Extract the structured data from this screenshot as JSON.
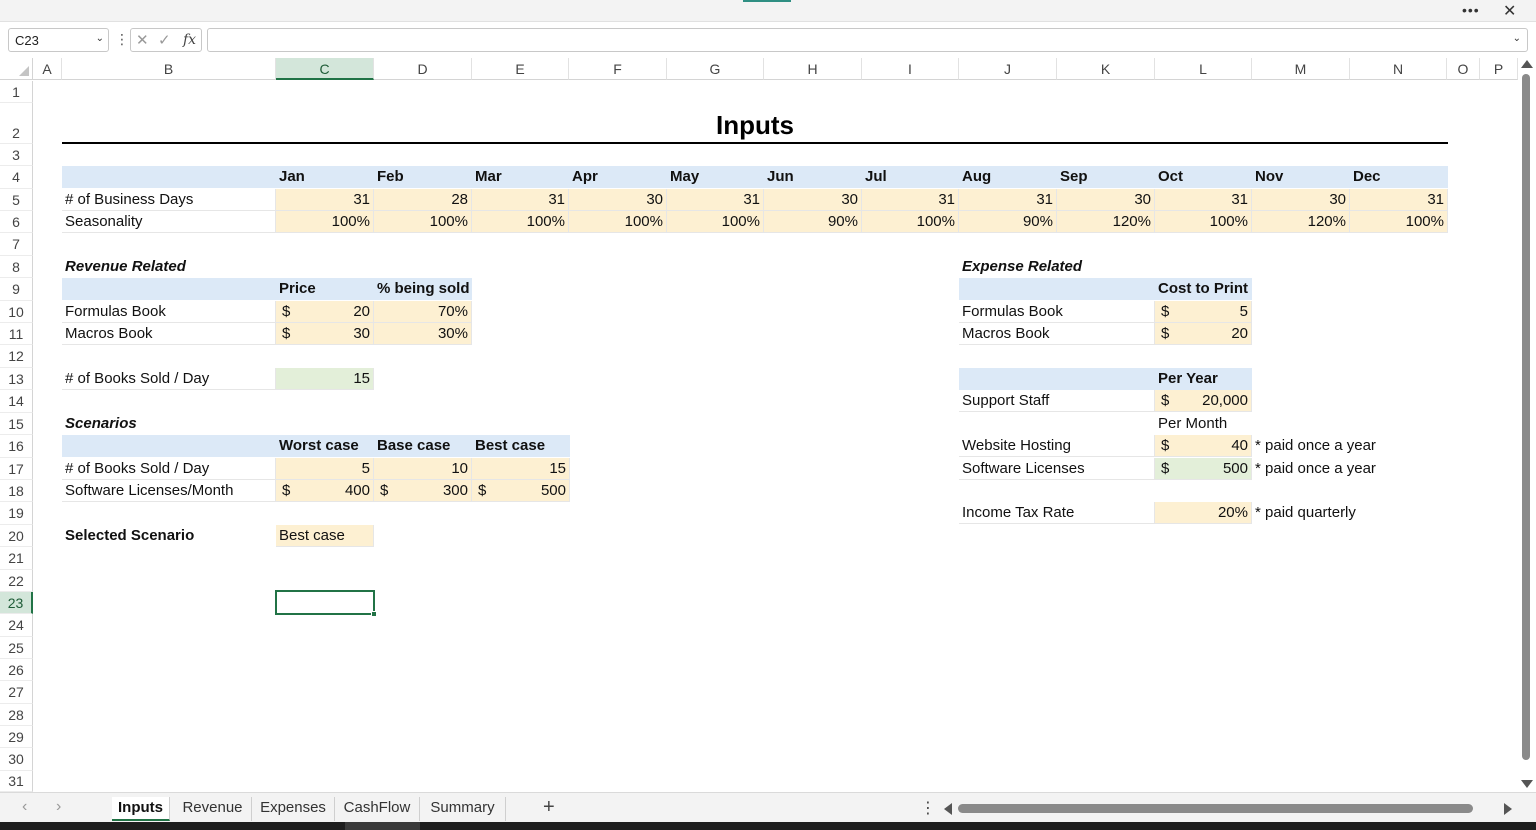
{
  "window": {
    "more_icon": "more-icon",
    "close_icon": "close-icon"
  },
  "formula_bar": {
    "name_box": "C23",
    "formula": ""
  },
  "columns": [
    "A",
    "B",
    "C",
    "D",
    "E",
    "F",
    "G",
    "H",
    "I",
    "J",
    "K",
    "L",
    "M",
    "N",
    "O",
    "P"
  ],
  "selected_column": "C",
  "rows": [
    "1",
    "2",
    "3",
    "4",
    "5",
    "6",
    "7",
    "8",
    "9",
    "10",
    "11",
    "12",
    "13",
    "14",
    "15",
    "16",
    "17",
    "18",
    "19",
    "20",
    "21",
    "22",
    "23",
    "24",
    "25",
    "26",
    "27",
    "28",
    "29",
    "30",
    "31"
  ],
  "selected_row": "23",
  "sheet": {
    "title": "Inputs",
    "months": [
      "Jan",
      "Feb",
      "Mar",
      "Apr",
      "May",
      "Jun",
      "Jul",
      "Aug",
      "Sep",
      "Oct",
      "Nov",
      "Dec"
    ],
    "business_days_label": "# of Business Days",
    "business_days": [
      "31",
      "28",
      "31",
      "30",
      "31",
      "30",
      "31",
      "31",
      "30",
      "31",
      "30",
      "31"
    ],
    "seasonality_label": "Seasonality",
    "seasonality": [
      "100%",
      "100%",
      "100%",
      "100%",
      "100%",
      "90%",
      "100%",
      "90%",
      "120%",
      "100%",
      "120%",
      "100%"
    ],
    "revenue": {
      "heading": "Revenue Related",
      "col_price": "Price",
      "col_pct": "% being sold",
      "rows": [
        {
          "name": "Formulas Book",
          "currency": "$",
          "price": "20",
          "pct": "70%"
        },
        {
          "name": "Macros Book",
          "currency": "$",
          "price": "30",
          "pct": "30%"
        }
      ]
    },
    "books_sold": {
      "label": "# of Books Sold / Day",
      "value": "15"
    },
    "scenarios": {
      "heading": "Scenarios",
      "cols": [
        "Worst case",
        "Base case",
        "Best case"
      ],
      "books_label": "# of Books Sold / Day",
      "books": [
        "5",
        "10",
        "15"
      ],
      "licenses_label": "Software Licenses/Month",
      "currency": "$",
      "licenses": [
        "400",
        "300",
        "500"
      ]
    },
    "selected_scenario": {
      "label": "Selected Scenario",
      "value": "Best case"
    },
    "expense": {
      "heading": "Expense Related",
      "col_cost": "Cost to Print",
      "rows": [
        {
          "name": "Formulas Book",
          "currency": "$",
          "value": "5"
        },
        {
          "name": "Macros Book",
          "currency": "$",
          "value": "20"
        }
      ],
      "per_year": "Per Year",
      "support_label": "Support Staff",
      "support_currency": "$",
      "support_value": "20,000",
      "per_month": "Per Month",
      "hosting_label": "Website Hosting",
      "hosting_currency": "$",
      "hosting_value": "40",
      "hosting_note": "* paid once a year",
      "licenses_label": "Software Licenses",
      "licenses_currency": "$",
      "licenses_value": "500",
      "licenses_note": "* paid once a year",
      "tax_label": "Income Tax Rate",
      "tax_value": "20%",
      "tax_note": "* paid quarterly"
    }
  },
  "tabs": [
    "Inputs",
    "Revenue",
    "Expenses",
    "CashFlow",
    "Summary"
  ],
  "active_tab": "Inputs",
  "add_sheet": "+",
  "colors": {
    "accent": "#217346",
    "header_blue": "#dce9f7",
    "input_yellow": "#fdf0d2",
    "input_green": "#e3efd9"
  }
}
